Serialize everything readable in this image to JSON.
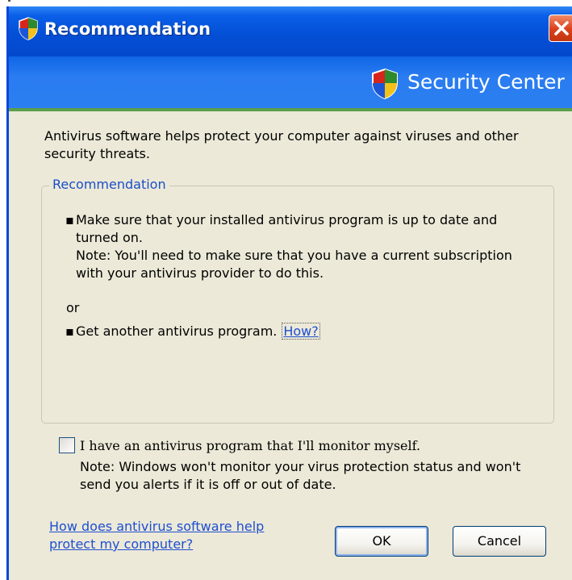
{
  "window": {
    "title": "Recommendation",
    "header_title": "Security Center"
  },
  "intro_text": "Antivirus software helps protect your computer against viruses and other security threats.",
  "recommendation": {
    "legend": "Recommendation",
    "bullet1": "Make sure that your installed antivirus program is up to date and turned on.",
    "bullet1_note": "Note: You'll need to make sure that you have a current subscription with your antivirus provider to do this.",
    "or_text": "or",
    "bullet2": "Get another antivirus program.",
    "how_link": "How?"
  },
  "monitor_checkbox": {
    "label": "I have an antivirus program that I'll monitor myself.",
    "note": "Note: Windows won't monitor your virus protection status and won't send you alerts if it is off or out of date.",
    "checked": false
  },
  "footer": {
    "help_link": "How does antivirus software help protect my computer?",
    "ok_label": "OK",
    "cancel_label": "Cancel"
  },
  "icons": {
    "title_icon": "security-shield-icon",
    "header_icon": "security-shield-icon",
    "close": "close-icon"
  },
  "colors": {
    "titlebar": "#0450d6",
    "close_button": "#d9401a",
    "link": "#1e4fd1",
    "dialog_background": "#ece9d8"
  }
}
